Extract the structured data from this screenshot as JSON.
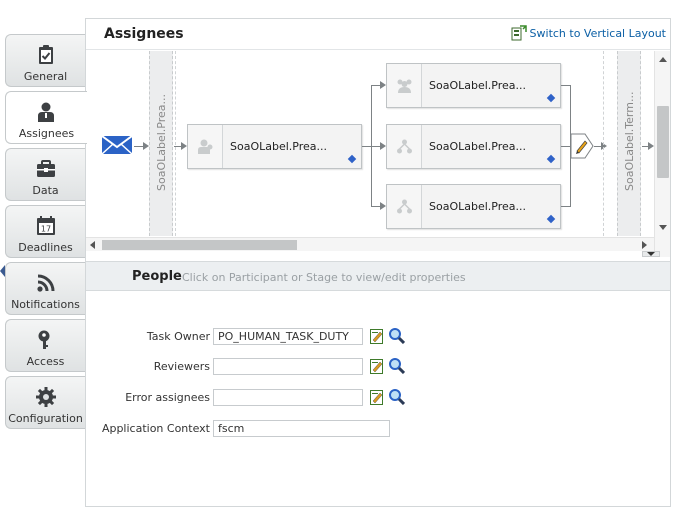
{
  "sidebar": {
    "tabs": [
      {
        "label": "General",
        "icon": "clipboard-check-icon"
      },
      {
        "label": "Assignees",
        "icon": "person-icon"
      },
      {
        "label": "Data",
        "icon": "briefcase-icon"
      },
      {
        "label": "Deadlines",
        "icon": "calendar-icon"
      },
      {
        "label": "Notifications",
        "icon": "rss-icon"
      },
      {
        "label": "Access",
        "icon": "key-icon"
      },
      {
        "label": "Configuration",
        "icon": "gear-icon"
      }
    ],
    "calendar_day": "17"
  },
  "header": {
    "title": "Assignees",
    "switch_label": "Switch to Vertical Layout"
  },
  "diagram": {
    "lane_left_label": "SoaOLabel.Prea...",
    "lane_right_label": "SoaOLabel.Term...",
    "main_node_label": "SoaOLabel.Prea...",
    "parallel_nodes": [
      "SoaOLabel.Prea...",
      "SoaOLabel.Prea...",
      "SoaOLabel.Prea..."
    ]
  },
  "people": {
    "title": "People",
    "hint": "Click on Participant or Stage to view/edit properties",
    "fields": {
      "task_owner_label": "Task Owner",
      "task_owner_value": "PO_HUMAN_TASK_DUTY",
      "reviewers_label": "Reviewers",
      "reviewers_value": "",
      "error_assignees_label": "Error assignees",
      "error_assignees_value": "",
      "app_context_label": "Application Context",
      "app_context_value": "fscm"
    }
  },
  "colors": {
    "accent_blue": "#2f62c8",
    "link_blue": "#0b5fa5",
    "tab_bg": "#dfe2e3",
    "people_bar": "#eceff1"
  }
}
